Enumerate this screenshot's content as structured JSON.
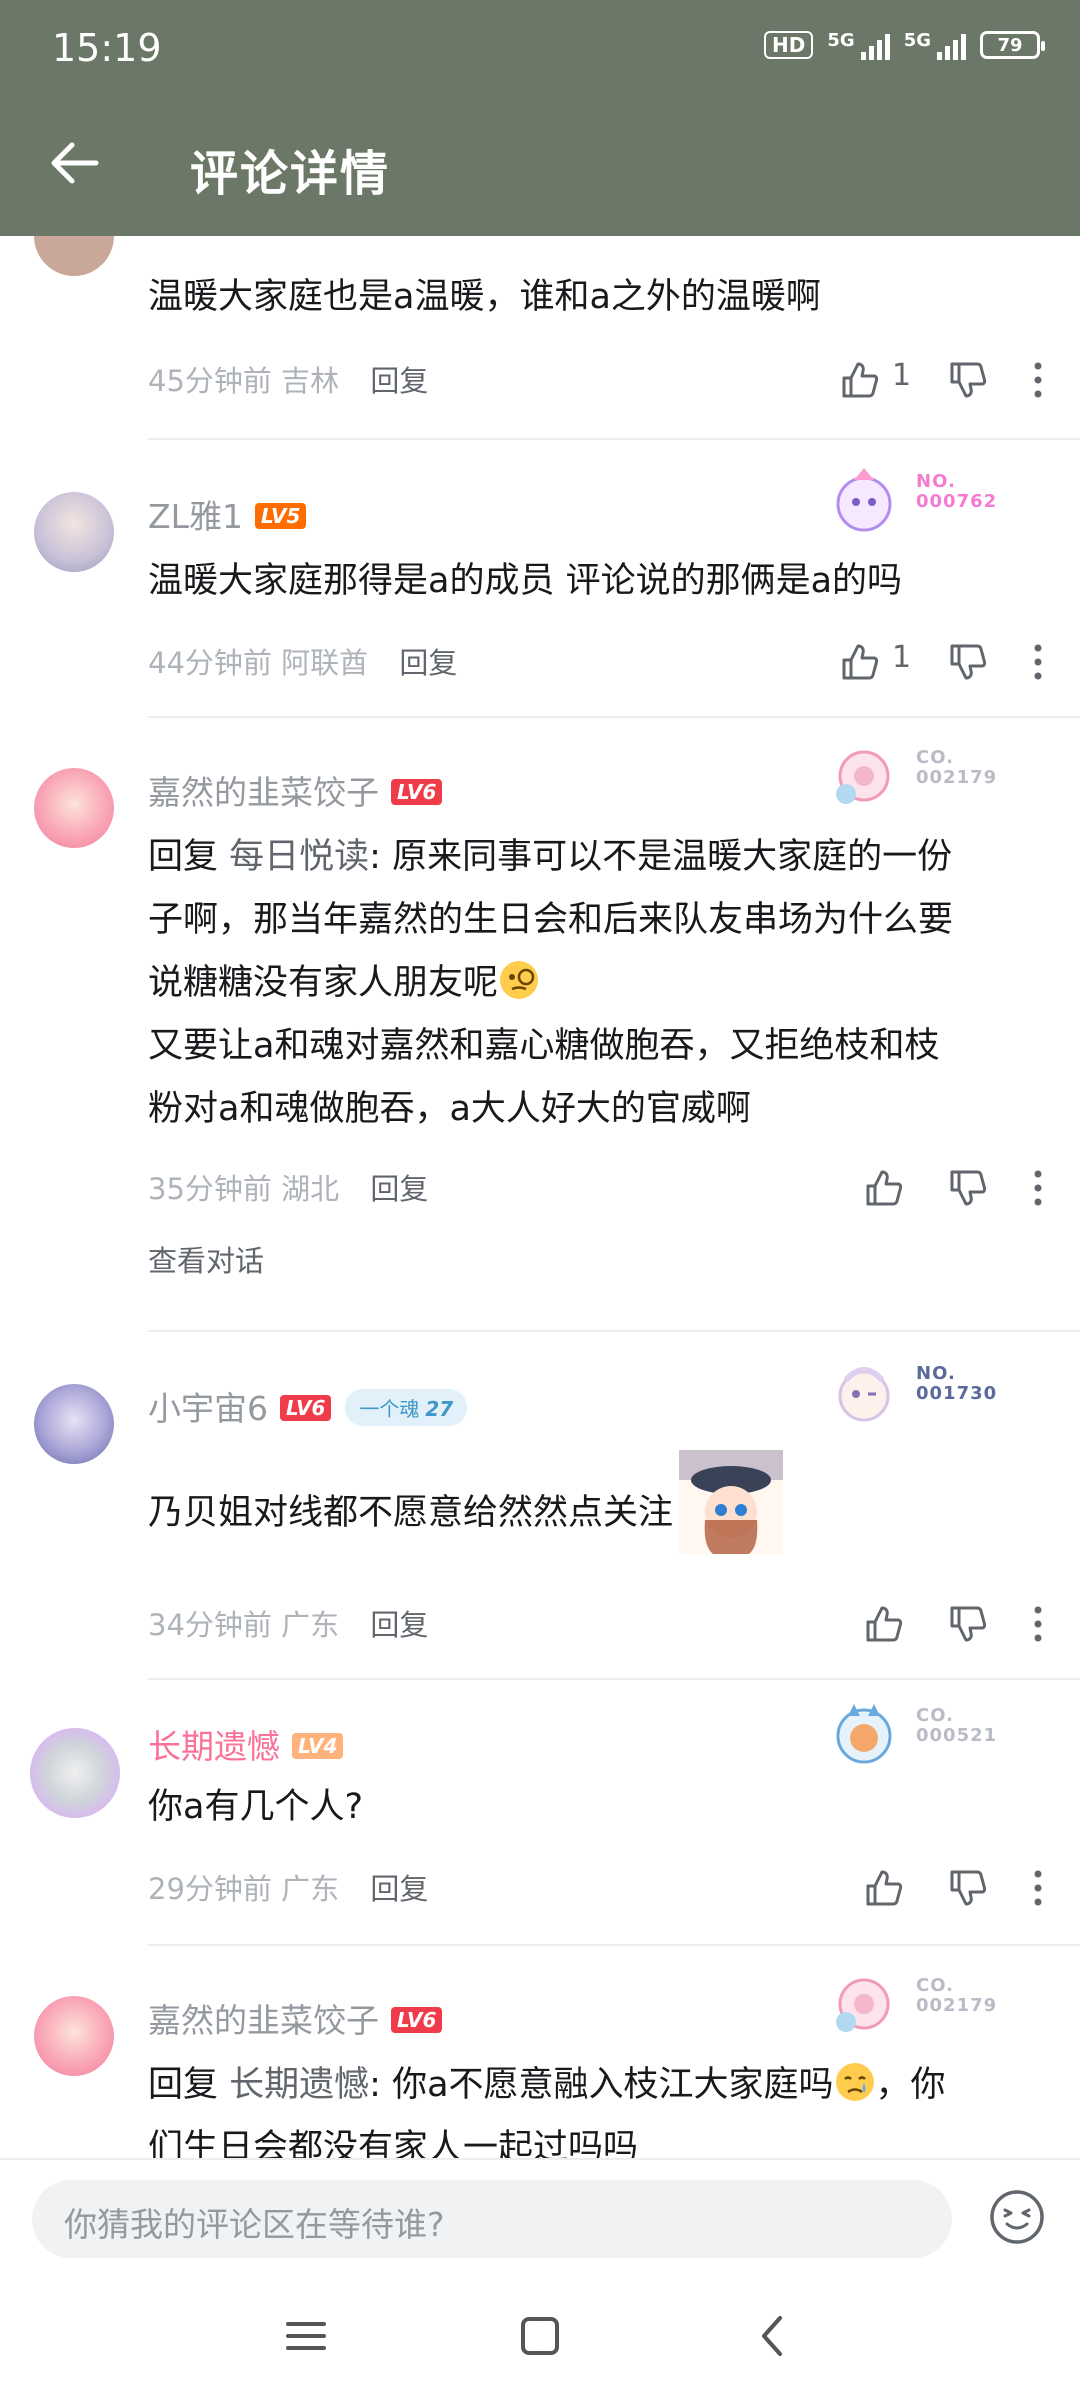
{
  "status_bar": {
    "time": "15:19",
    "hd": "HD",
    "net1": "5G",
    "net2": "5G",
    "battery": "79"
  },
  "header": {
    "title": "评论详情"
  },
  "comments": [
    {
      "text": "温暖大家庭也是a温暖，谁和a之外的温暖啊",
      "time": "45分钟前",
      "location": "吉林",
      "reply_label": "回复",
      "likes": "1"
    },
    {
      "username": "ZL雅1",
      "level": "LV5",
      "deco_no": "NO.\n000762",
      "text": "温暖大家庭那得是a的成员  评论说的那俩是a的吗",
      "time": "44分钟前",
      "location": "阿联酋",
      "reply_label": "回复",
      "likes": "1"
    },
    {
      "username": "嘉然的韭菜饺子",
      "level": "LV6",
      "deco_no": "CO.\n002179",
      "reply_prefix": "回复 ",
      "reply_to": "每日悦读",
      "text_line1_rest": ": 原来同事可以不是温暖大家庭的一份",
      "text_line2": "子啊，那当年嘉然的生日会和后来队友串场为什么要",
      "text_line3": "说糖糖没有家人朋友呢",
      "text_line4": "又要让a和魂对嘉然和嘉心糖做胞吞，又拒绝枝和枝",
      "text_line5": "粉对a和魂做胞吞，a大人好大的官威啊",
      "time": "35分钟前",
      "location": "湖北",
      "reply_label": "回复",
      "view_conversation": "查看对话"
    },
    {
      "username": "小宇宙6",
      "level": "LV6",
      "fan_badge_name": "一个魂",
      "fan_badge_level": "27",
      "deco_no": "NO.\n001730",
      "text": "乃贝姐对线都不愿意给然然点关注",
      "time": "34分钟前",
      "location": "广东",
      "reply_label": "回复"
    },
    {
      "username": "长期遗憾",
      "level": "LV4",
      "deco_no": "CO.\n000521",
      "text": "你a有几个人?",
      "time": "29分钟前",
      "location": "广东",
      "reply_label": "回复"
    },
    {
      "username": "嘉然的韭菜饺子",
      "level": "LV6",
      "deco_no": "CO.\n002179",
      "reply_prefix": "回复 ",
      "reply_to": "长期遗憾",
      "text_line1_rest": ": 你a不愿意融入枝江大家庭吗",
      "text_line1_tail": "，你",
      "text_line2": "们生日会都没有家人一起过吗吗"
    }
  ],
  "input": {
    "placeholder": "你猜我的评论区在等待谁?"
  },
  "colors": {
    "header_bg": "#6b7867",
    "vip_name": "#fb7299",
    "link": "#61666d"
  }
}
